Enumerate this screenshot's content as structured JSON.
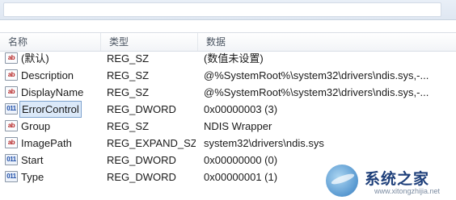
{
  "header": {
    "col_name": "名称",
    "col_type": "类型",
    "col_data": "数据"
  },
  "values": [
    {
      "icon": "ab",
      "name": "(默认)",
      "type": "REG_SZ",
      "data": "(数值未设置)"
    },
    {
      "icon": "ab",
      "name": "Description",
      "type": "REG_SZ",
      "data": "@%SystemRoot%\\system32\\drivers\\ndis.sys,-..."
    },
    {
      "icon": "ab",
      "name": "DisplayName",
      "type": "REG_SZ",
      "data": "@%SystemRoot%\\system32\\drivers\\ndis.sys,-..."
    },
    {
      "icon": "binary",
      "name": "ErrorControl",
      "type": "REG_DWORD",
      "data": "0x00000003 (3)",
      "selected": true
    },
    {
      "icon": "ab",
      "name": "Group",
      "type": "REG_SZ",
      "data": "NDIS Wrapper"
    },
    {
      "icon": "ab",
      "name": "ImagePath",
      "type": "REG_EXPAND_SZ",
      "data": "system32\\drivers\\ndis.sys"
    },
    {
      "icon": "binary",
      "name": "Start",
      "type": "REG_DWORD",
      "data": "0x00000000 (0)"
    },
    {
      "icon": "binary",
      "name": "Type",
      "type": "REG_DWORD",
      "data": "0x00000001 (1)"
    }
  ],
  "icon_glyphs": {
    "ab": "ab",
    "binary": "011"
  },
  "watermark": {
    "text": "系统之家",
    "sub": "www.xitongzhijia.net"
  }
}
